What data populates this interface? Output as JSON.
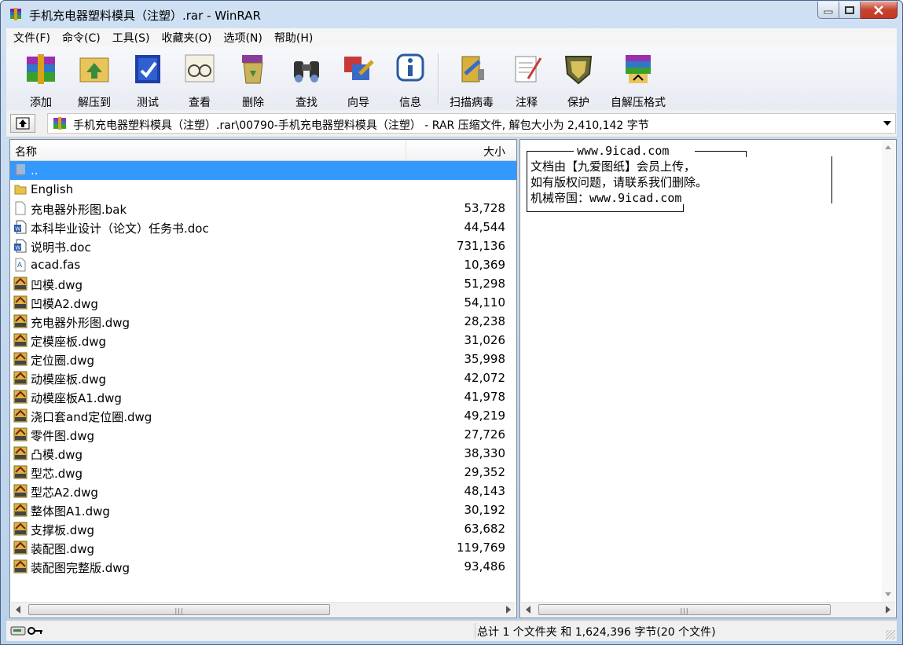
{
  "window": {
    "title": "手机充电器塑料模具（注塑）.rar - WinRAR"
  },
  "menu": [
    "文件(F)",
    "命令(C)",
    "工具(S)",
    "收藏夹(O)",
    "选项(N)",
    "帮助(H)"
  ],
  "toolbar": {
    "add": "添加",
    "extract": "解压到",
    "test": "测试",
    "view": "查看",
    "delete": "删除",
    "find": "查找",
    "wizard": "向导",
    "info": "信息",
    "scan": "扫描病毒",
    "comment": "注释",
    "protect": "保护",
    "sfx": "自解压格式"
  },
  "address": {
    "path": "手机充电器塑料模具（注塑）.rar\\00790-手机充电器塑料模具（注塑） - RAR 压缩文件, 解包大小为 2,410,142 字节"
  },
  "list": {
    "col_name": "名称",
    "col_size": "大小",
    "files": [
      {
        "name": "..",
        "size": "",
        "type": "up"
      },
      {
        "name": "English",
        "size": "",
        "type": "folder"
      },
      {
        "name": "充电器外形图.bak",
        "size": "53,728",
        "type": "bak"
      },
      {
        "name": "本科毕业设计（论文）任务书.doc",
        "size": "44,544",
        "type": "doc"
      },
      {
        "name": "说明书.doc",
        "size": "731,136",
        "type": "doc"
      },
      {
        "name": "acad.fas",
        "size": "10,369",
        "type": "fas"
      },
      {
        "name": "凹模.dwg",
        "size": "51,298",
        "type": "dwg"
      },
      {
        "name": "凹模A2.dwg",
        "size": "54,110",
        "type": "dwg"
      },
      {
        "name": "充电器外形图.dwg",
        "size": "28,238",
        "type": "dwg"
      },
      {
        "name": "定模座板.dwg",
        "size": "31,026",
        "type": "dwg"
      },
      {
        "name": "定位圈.dwg",
        "size": "35,998",
        "type": "dwg"
      },
      {
        "name": "动模座板.dwg",
        "size": "42,072",
        "type": "dwg"
      },
      {
        "name": "动模座板A1.dwg",
        "size": "41,978",
        "type": "dwg"
      },
      {
        "name": "浇口套and定位圈.dwg",
        "size": "49,219",
        "type": "dwg"
      },
      {
        "name": "零件图.dwg",
        "size": "27,726",
        "type": "dwg"
      },
      {
        "name": "凸模.dwg",
        "size": "38,330",
        "type": "dwg"
      },
      {
        "name": "型芯.dwg",
        "size": "29,352",
        "type": "dwg"
      },
      {
        "name": "型芯A2.dwg",
        "size": "48,143",
        "type": "dwg"
      },
      {
        "name": "整体图A1.dwg",
        "size": "30,192",
        "type": "dwg"
      },
      {
        "name": "支撑板.dwg",
        "size": "63,682",
        "type": "dwg"
      },
      {
        "name": "装配图.dwg",
        "size": "119,769",
        "type": "dwg"
      },
      {
        "name": "装配图完整版.dwg",
        "size": "93,486",
        "type": "dwg"
      }
    ]
  },
  "comment": {
    "header": "www.9icad.com",
    "lines": [
      "文档由【九爱图纸】会员上传，",
      "如有版权问题，请联系我们删除。",
      "机械帝国：www.9icad.com"
    ]
  },
  "status": {
    "summary": "总计 1 个文件夹 和 1,624,396 字节(20 个文件)"
  },
  "colors": {
    "selection": "#3399ff",
    "title_gradient": "#b9d1ea"
  }
}
